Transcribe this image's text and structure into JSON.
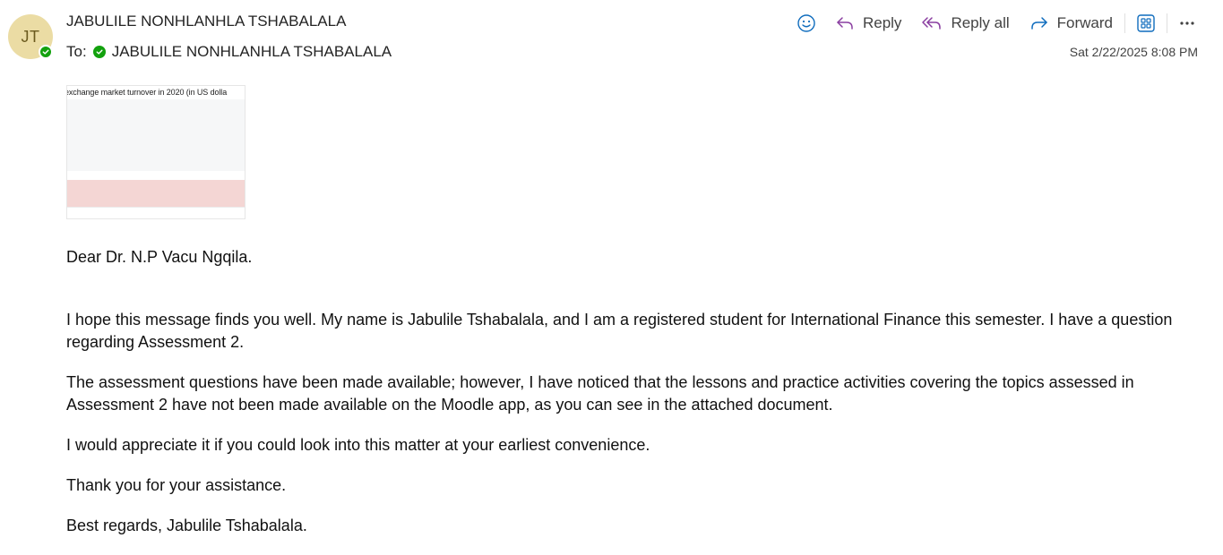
{
  "sender": {
    "initials": "JT",
    "name": "JABULILE NONHLANHLA TSHABALALA"
  },
  "recipients": {
    "label": "To:",
    "name": "JABULILE NONHLANHLA TSHABALALA"
  },
  "timestamp": "Sat 2/22/2025 8:08 PM",
  "toolbar": {
    "reply": "Reply",
    "reply_all": "Reply all",
    "forward": "Forward"
  },
  "icons": {
    "emoji": "smiley-icon",
    "reply": "reply-arrow-icon",
    "reply_all": "reply-all-arrow-icon",
    "forward": "forward-arrow-icon",
    "apps": "apps-grid-icon",
    "more": "more-dots-icon"
  },
  "colors": {
    "accent": "#0f6cbd",
    "reply_purple": "#8a3ea0",
    "presence_green": "#13a10e",
    "avatar_bg": "#ebdca4"
  },
  "attachment": {
    "title": "exchange market turnover in 2020 (in US dolla"
  },
  "message": {
    "greeting": "Dear Dr. N.P Vacu Ngqila.",
    "paragraphs": [
      "I hope this message finds you well. My name is Jabulile Tshabalala, and I am a registered student for International Finance this semester. I have a question regarding Assessment 2.",
      "The assessment questions have been made available; however, I have noticed that the lessons and practice activities covering the topics assessed in Assessment 2 have not been made available on the Moodle app, as you can see in the attached document.",
      "I would appreciate it if you could look into this matter at your earliest convenience.",
      "Thank you for your assistance.",
      "Best regards, Jabulile Tshabalala."
    ]
  }
}
